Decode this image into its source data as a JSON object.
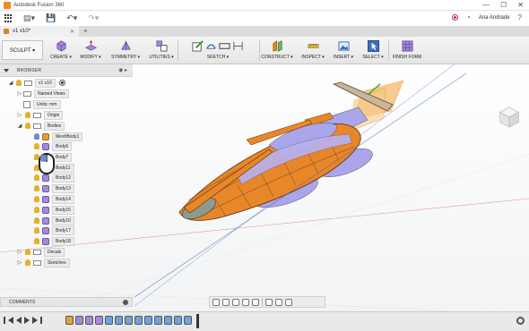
{
  "window": {
    "title": "Autodesk Fusion 360",
    "controls": [
      "—",
      "☐",
      "✕"
    ]
  },
  "quickbar": {
    "user": "Ana Andrade",
    "help": "?"
  },
  "document": {
    "tab_label": "v1 v10*",
    "close": "✕",
    "new_tab": "+"
  },
  "workspace": {
    "label": "SCULPT ▾"
  },
  "toolbar": {
    "groups": [
      {
        "label": "CREATE ▾"
      },
      {
        "label": "MODIFY ▾"
      },
      {
        "label": "SYMMETRY ▾"
      },
      {
        "label": "UTILITIES ▾"
      },
      {
        "label": "SKETCH ▾"
      },
      {
        "label": "CONSTRUCT ▾"
      },
      {
        "label": "INSPECT ▾"
      },
      {
        "label": "INSERT ▾"
      },
      {
        "label": "SELECT ▾"
      },
      {
        "label": "FINISH FORM"
      }
    ]
  },
  "browser": {
    "title": "BROWSER",
    "root": "v1 v10",
    "items": [
      {
        "label": "Named Views"
      },
      {
        "label": "Units: mm"
      },
      {
        "label": "Origin"
      },
      {
        "label": "Bodies"
      },
      {
        "label": "MeshBody1"
      },
      {
        "label": "Body6"
      },
      {
        "label": "Body7"
      },
      {
        "label": "Body11"
      },
      {
        "label": "Body12"
      },
      {
        "label": "Body13"
      },
      {
        "label": "Body14"
      },
      {
        "label": "Body15"
      },
      {
        "label": "Body16"
      },
      {
        "label": "Body17"
      },
      {
        "label": "Body18"
      },
      {
        "label": "Decals"
      },
      {
        "label": "Sketches"
      }
    ]
  },
  "comments": {
    "label": "COMMENTS"
  },
  "colors": {
    "accent_orange": "#e8862a",
    "body_purple": "#a58ad8",
    "selection_blue": "#3b6fb6"
  }
}
